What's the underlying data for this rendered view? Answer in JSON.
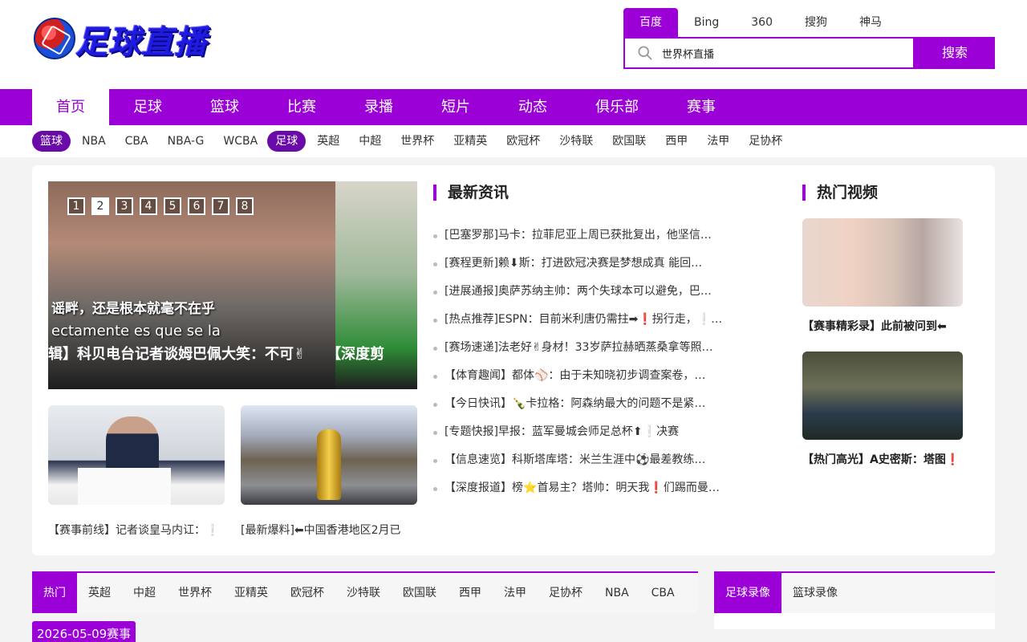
{
  "site": {
    "logo_text": "足球直播"
  },
  "search": {
    "engines": [
      "百度",
      "Bing",
      "360",
      "搜狗",
      "神马"
    ],
    "active_engine": 0,
    "query": "世界杯直播",
    "button_label": "搜索"
  },
  "main_nav": [
    "首页",
    "足球",
    "篮球",
    "比赛",
    "录播",
    "短片",
    "动态",
    "俱乐部",
    "赛事"
  ],
  "sub_nav": [
    {
      "label": "篮球",
      "tag": true
    },
    {
      "label": "NBA"
    },
    {
      "label": "CBA"
    },
    {
      "label": "NBA-G"
    },
    {
      "label": "WCBA"
    },
    {
      "label": "足球",
      "tag": true
    },
    {
      "label": "英超"
    },
    {
      "label": "中超"
    },
    {
      "label": "世界杯"
    },
    {
      "label": "亚精英"
    },
    {
      "label": "欧冠杯"
    },
    {
      "label": "沙特联"
    },
    {
      "label": "欧国联"
    },
    {
      "label": "西甲"
    },
    {
      "label": "法甲"
    },
    {
      "label": "足协杯"
    }
  ],
  "slider": {
    "dots": [
      "1",
      "2",
      "3",
      "4",
      "5",
      "6",
      "7",
      "8"
    ],
    "active_dot": 1,
    "subtitle_cn": "谣畔，还是根本就毫不在乎",
    "subtitle_es": "ectamente es que se la",
    "caption_1": "辑】科贝电台记者谈姆巴佩大笑：不可✌",
    "caption_2": "【深度剪"
  },
  "thumbs": [
    {
      "caption": "【赛事前线】记者谈皇马内讧：❕"
    },
    {
      "caption": "[最新爆料]⬅中国香港地区2月已"
    }
  ],
  "latest_news": {
    "title": "最新资讯",
    "items": [
      "[巴塞罗那]马卡：拉菲尼亚上周已获批复出，他坚信…",
      "[赛程更新]赖⬇斯：打进欧冠决赛是梦想成真 能回…",
      "[进展通报]奥萨苏纳主帅：两个失球本可以避免，巴…",
      "[热点推荐]ESPN：目前米利唐仍需拄➡❗拐行走，❕…",
      "[赛场速递]法老好✌身材！33岁萨拉赫晒蒸桑拿等照…",
      "【体育趣闻】都体⚾：由于未知晓初步调查案卷，…",
      "【今日快讯】🍾卡拉格：阿森纳最大的问题不是紧…",
      "[专题快报]早报：蓝军曼城会师足总杯⬆❕决赛",
      "【信息速览】科斯塔库塔：米兰生涯中⚽最差教练…",
      "【深度报道】榜⭐首易主？塔帅：明天我❗们踢而曼…"
    ]
  },
  "hot_videos": {
    "title": "热门视频",
    "items": [
      {
        "caption": "【赛事精彩录】此前被问到⬅"
      },
      {
        "caption": "【热门高光】A史密斯：塔图❗"
      }
    ]
  },
  "bottom_tabs": [
    "热门",
    "英超",
    "中超",
    "世界杯",
    "亚精英",
    "欧冠杯",
    "沙特联",
    "欧国联",
    "西甲",
    "法甲",
    "足协杯",
    "NBA",
    "CBA"
  ],
  "replay_tabs": [
    "足球录像",
    "篮球录像"
  ],
  "date_label": "2026-05-09赛事",
  "colors": {
    "accent": "#9b00d6",
    "tag": "#6a0aa8"
  }
}
